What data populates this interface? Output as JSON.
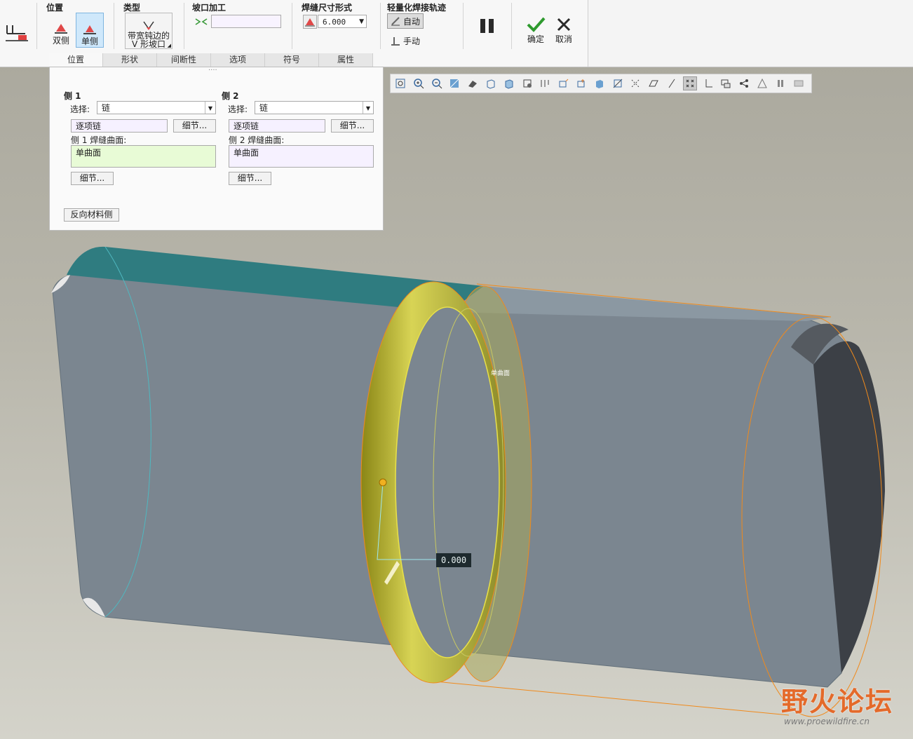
{
  "ribbon": {
    "groups": {
      "position": "位置",
      "type": "类型",
      "groove": "坡口加工",
      "size_form": "焊缝尺寸形式",
      "trajectory": "轻量化焊接轨迹"
    },
    "position_buttons": {
      "double": "双侧",
      "single": "单侧"
    },
    "type_button": {
      "line1": "带宽钝边的",
      "line2": "V 形坡口"
    },
    "size_value": "6.000",
    "trajectory_buttons": {
      "auto": "自动",
      "manual": "手动"
    },
    "ok_label": "确定",
    "cancel_label": "取消"
  },
  "tabs": [
    {
      "label": "位置"
    },
    {
      "label": "形状"
    },
    {
      "label": "间断性"
    },
    {
      "label": "选项"
    },
    {
      "label": "符号"
    },
    {
      "label": "属性"
    }
  ],
  "panel": {
    "handle": "....",
    "side1": {
      "title": "侧 1",
      "select_label": "选择:",
      "select_value": "链",
      "chain_field": "逐项链",
      "detail_btn": "细节...",
      "surface_label": "侧 1 焊缝曲面:",
      "surface_value": "单曲面",
      "detail_btn2": "细节..."
    },
    "side2": {
      "title": "侧 2",
      "select_label": "选择:",
      "select_value": "链",
      "chain_field": "逐项链",
      "detail_btn": "细节...",
      "surface_label": "侧 2 焊缝曲面:",
      "surface_value": "单曲面",
      "detail_btn2": "细节..."
    },
    "reverse_btn": "反向材料侧"
  },
  "viewport": {
    "surface_tag": "单曲面",
    "dimension_value": "0.000"
  },
  "watermark": {
    "brand": "野火论坛",
    "url": "www.proewildfire.cn"
  },
  "colors": {
    "accent_blue": "#cfe8fb",
    "weld_yellow": "#c9c43a",
    "highlight_orange": "#f08a1c"
  }
}
